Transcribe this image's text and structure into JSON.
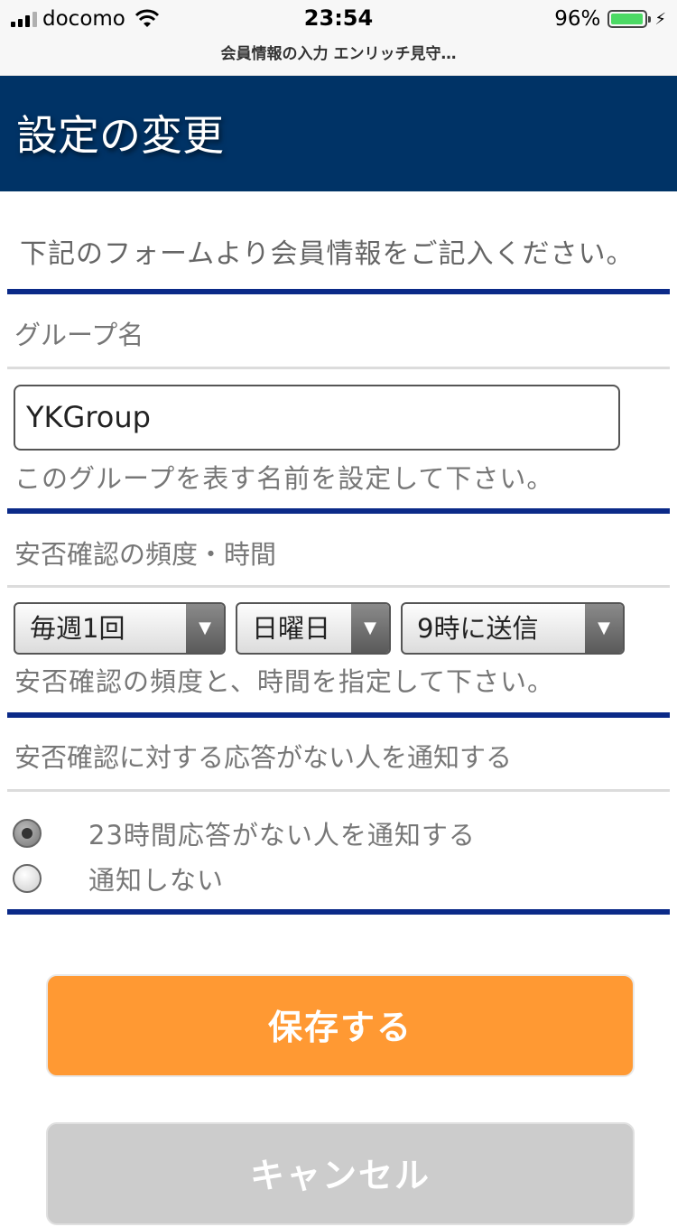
{
  "status": {
    "carrier": "docomo",
    "time": "23:54",
    "battery_percent": "96%",
    "battery_level": 0.96,
    "battery_color": "#4cd964"
  },
  "browser": {
    "page_title": "会員情報の入力 エンリッチ見守…"
  },
  "header": {
    "title": "設定の変更",
    "bg_color": "#003366"
  },
  "form": {
    "intro": "下記のフォームより会員情報をご記入ください。",
    "group": {
      "label": "グループ名",
      "value": "YKGroup",
      "hint": "このグループを表す名前を設定して下さい。"
    },
    "frequency": {
      "label": "安否確認の頻度・時間",
      "select1": "毎週1回",
      "select2": "日曜日",
      "select3": "9時に送信",
      "hint": "安否確認の頻度と、時間を指定して下さい。"
    },
    "notify": {
      "label": "安否確認に対する応答がない人を通知する",
      "option1": "23時間応答がない人を通知する",
      "option2": "通知しない",
      "selected": "option1"
    }
  },
  "buttons": {
    "save": "保存する",
    "cancel": "キャンセル",
    "save_color": "#ff9933",
    "cancel_color": "#cccccc"
  }
}
